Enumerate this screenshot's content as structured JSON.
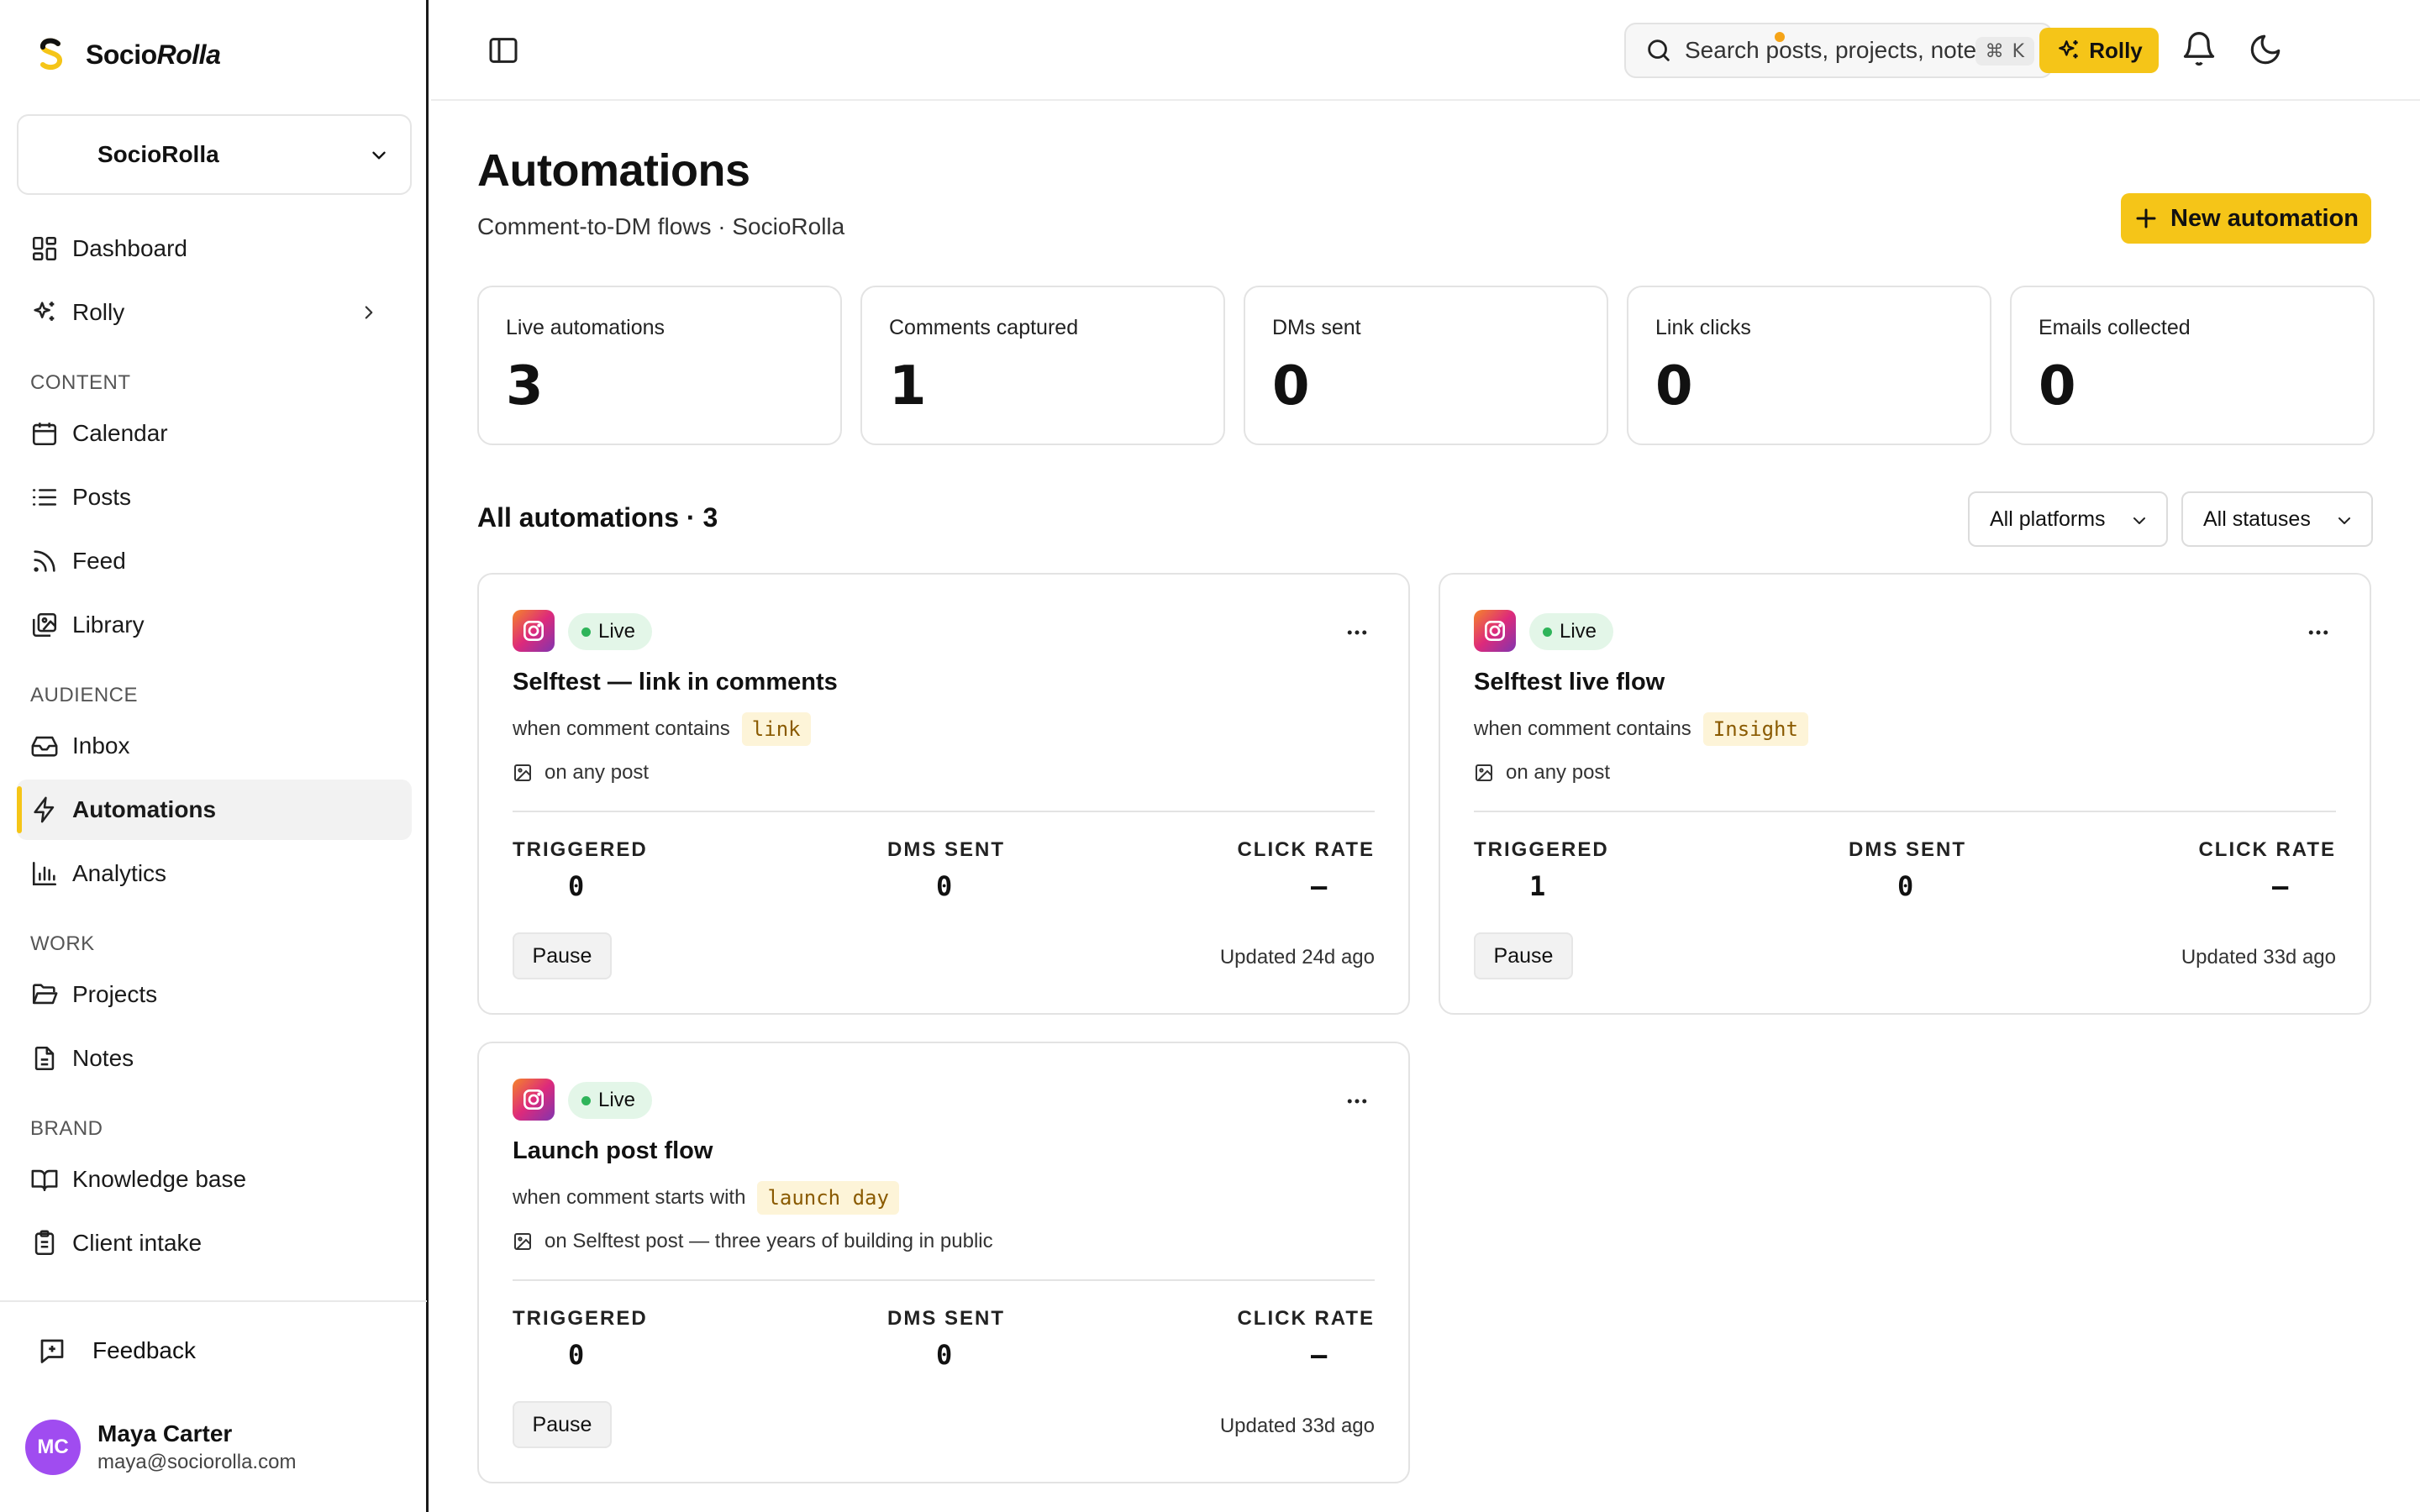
{
  "app": {
    "brand_prefix": "Socio",
    "brand_suffix": "Rolla",
    "workspace": "SocioRolla"
  },
  "sidebar": {
    "top_items": [
      {
        "label": "Dashboard",
        "icon": "grid-icon"
      },
      {
        "label": "Rolly",
        "icon": "sparkles-icon"
      }
    ],
    "sections": [
      {
        "label": "CONTENT",
        "items": [
          "Calendar",
          "Posts",
          "Feed",
          "Library"
        ]
      },
      {
        "label": "AUDIENCE",
        "items": [
          "Inbox",
          "Automations",
          "Analytics"
        ]
      },
      {
        "label": "WORK",
        "items": [
          "Projects",
          "Notes"
        ]
      },
      {
        "label": "BRAND",
        "items": [
          "Knowledge base",
          "Client intake"
        ]
      }
    ],
    "active": "Automations",
    "feedback": "Feedback",
    "user": {
      "initials": "MC",
      "name": "Maya Carter",
      "email": "maya@sociorolla.com"
    }
  },
  "topbar": {
    "search_placeholder": "Search posts, projects, notes...",
    "shortcut_symbol": "⌘",
    "shortcut_key": "K",
    "rolly_label": "Rolly"
  },
  "page": {
    "title": "Automations",
    "subtitle": "Comment-to-DM flows · SocioRolla",
    "new_button": "New automation"
  },
  "stats": [
    {
      "label": "Live automations",
      "value": "3"
    },
    {
      "label": "Comments captured",
      "value": "1"
    },
    {
      "label": "DMs sent",
      "value": "0"
    },
    {
      "label": "Link clicks",
      "value": "0"
    },
    {
      "label": "Emails collected",
      "value": "0"
    }
  ],
  "list": {
    "title": "All automations · 3",
    "filter_platform": "All platforms",
    "filter_status": "All statuses"
  },
  "metric_labels": {
    "triggered": "TRIGGERED",
    "dms_sent": "DMS SENT",
    "click_rate": "CLICK RATE"
  },
  "automations": [
    {
      "status": "Live",
      "title": "Selftest — link in comments",
      "condition": "when comment contains",
      "keyword": "link",
      "scope": "on any post",
      "triggered": "0",
      "dms_sent": "0",
      "click_rate": "–",
      "action": "Pause",
      "updated": "Updated 24d ago"
    },
    {
      "status": "Live",
      "title": "Selftest live flow",
      "condition": "when comment contains",
      "keyword": "Insight",
      "scope": "on any post",
      "triggered": "1",
      "dms_sent": "0",
      "click_rate": "–",
      "action": "Pause",
      "updated": "Updated 33d ago"
    },
    {
      "status": "Live",
      "title": "Launch post flow",
      "condition": "when comment starts with",
      "keyword": "launch day",
      "scope": "on Selftest post — three years of building in public",
      "triggered": "0",
      "dms_sent": "0",
      "click_rate": "–",
      "action": "Pause",
      "updated": "Updated 33d ago"
    }
  ],
  "colors": {
    "accent": "#f5c518",
    "live_bg": "#e3f6e8",
    "live_dot": "#2fb45a",
    "avatar": "#a04cf0"
  }
}
